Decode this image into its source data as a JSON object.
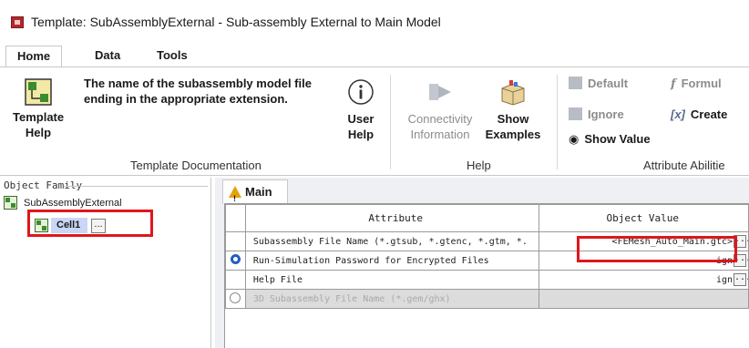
{
  "window": {
    "title": "Template: SubAssemblyExternal - Sub-assembly External to Main Model"
  },
  "ribbon": {
    "tabs": [
      "Home",
      "Data",
      "Tools"
    ],
    "template_help": {
      "line1": "Template",
      "line2": "Help"
    },
    "doc_description": "The name of the subassembly model file ending in the appropriate extension.",
    "user_help": {
      "line1": "User",
      "line2": "Help"
    },
    "template_documentation_label": "Template Documentation",
    "connectivity": {
      "line1": "Connectivity",
      "line2": "Information"
    },
    "show_examples": {
      "line1": "Show",
      "line2": "Examples"
    },
    "help_group_label": "Help",
    "default_label": "Default",
    "ignore_label": "Ignore",
    "show_value_label": "Show Value",
    "formula_label": "Formul",
    "create_label": "Create",
    "attribute_group_label": "Attribute Abilitie",
    "colors": {
      "accent": "#1f5fbf",
      "highlight": "#e0161b",
      "tab_selected": "#c9d7f5"
    }
  },
  "family": {
    "header": "Object Family",
    "root": "SubAssemblyExternal",
    "child": "Cell1",
    "ellipsis": "..."
  },
  "main": {
    "tab": "Main",
    "columns": {
      "attribute": "Attribute",
      "value": "Object Value"
    },
    "rows": [
      {
        "attribute": "Subassembly File Name (*.gtsub, *.gtenc, *.gtm, *.",
        "value": "<FEMesh_Auto_Main.gtc>",
        "btn": "..."
      },
      {
        "attribute": "Run-Simulation Password for Encrypted Files",
        "value": "ign",
        "btn": "..."
      },
      {
        "attribute": "Help File",
        "value": "ign",
        "btn": "..."
      },
      {
        "attribute": "3D Subassembly File Name (*.gem/ghx)",
        "value": ""
      }
    ]
  }
}
